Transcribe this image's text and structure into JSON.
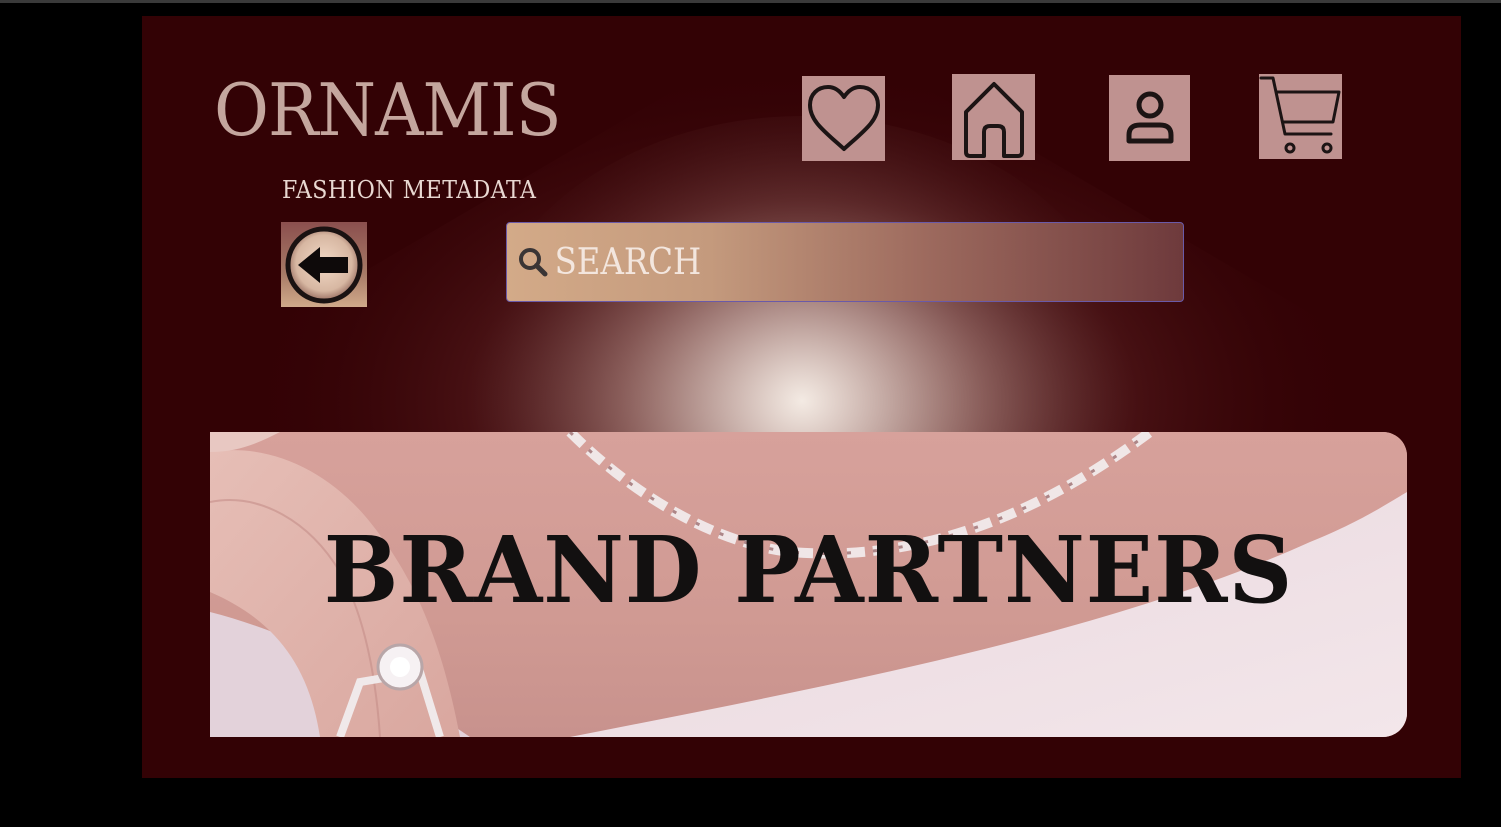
{
  "brand": {
    "name": "ORNAMIS",
    "tagline": "FASHION METADATA"
  },
  "nav": {
    "icons": [
      "heart-icon",
      "home-icon",
      "user-icon",
      "cart-icon"
    ]
  },
  "search": {
    "placeholder": "SEARCH",
    "value": ""
  },
  "banner": {
    "title": "BRAND PARTNERS"
  },
  "colors": {
    "background": "#330205",
    "logo": "#c4a69e",
    "icon_tile": "#bf9290",
    "glow": "#efe4dc"
  }
}
